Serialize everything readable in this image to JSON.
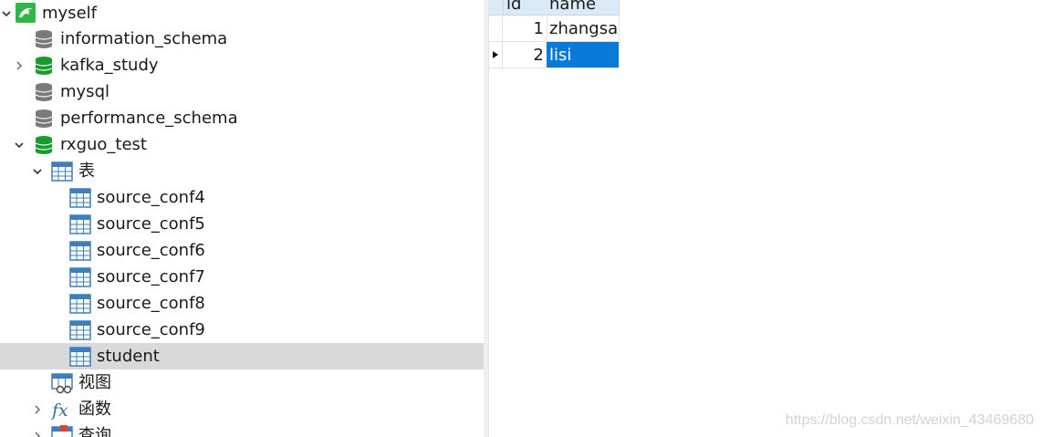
{
  "tree": {
    "connection": {
      "label": "myself",
      "expanded": true,
      "icon": "dolphin-connection-icon"
    },
    "databases": [
      {
        "label": "information_schema",
        "state": "closed",
        "icon": "database-gray-icon"
      },
      {
        "label": "kafka_study",
        "state": "collapsed",
        "icon": "database-green-icon"
      },
      {
        "label": "mysql",
        "state": "closed",
        "icon": "database-gray-icon"
      },
      {
        "label": "performance_schema",
        "state": "closed",
        "icon": "database-gray-icon"
      },
      {
        "label": "rxguo_test",
        "state": "expanded",
        "icon": "database-green-icon"
      }
    ],
    "tables_folder": {
      "label": "表",
      "expanded": true
    },
    "tables": [
      {
        "label": "source_conf4"
      },
      {
        "label": "source_conf5"
      },
      {
        "label": "source_conf6"
      },
      {
        "label": "source_conf7"
      },
      {
        "label": "source_conf8"
      },
      {
        "label": "source_conf9"
      },
      {
        "label": "student",
        "selected": true
      }
    ],
    "views_folder": {
      "label": "视图"
    },
    "functions_folder": {
      "label": "函数"
    },
    "queries_folder": {
      "label": "查询"
    }
  },
  "grid": {
    "columns": [
      "id",
      "name"
    ],
    "rows": [
      {
        "id": "1",
        "name": "zhangsan",
        "current": false
      },
      {
        "id": "2",
        "name": "lisi",
        "current": true
      }
    ],
    "selection_color": "#0a7ad9"
  },
  "watermark": "https://blog.csdn.net/weixin_43469680",
  "colors": {
    "db_green": "#1a9b2e",
    "db_gray": "#7a7a7a",
    "table_blue": "#3d7ebf",
    "selected_row_bg": "#d9d9d9",
    "header_bg": "#dbeaf7"
  }
}
